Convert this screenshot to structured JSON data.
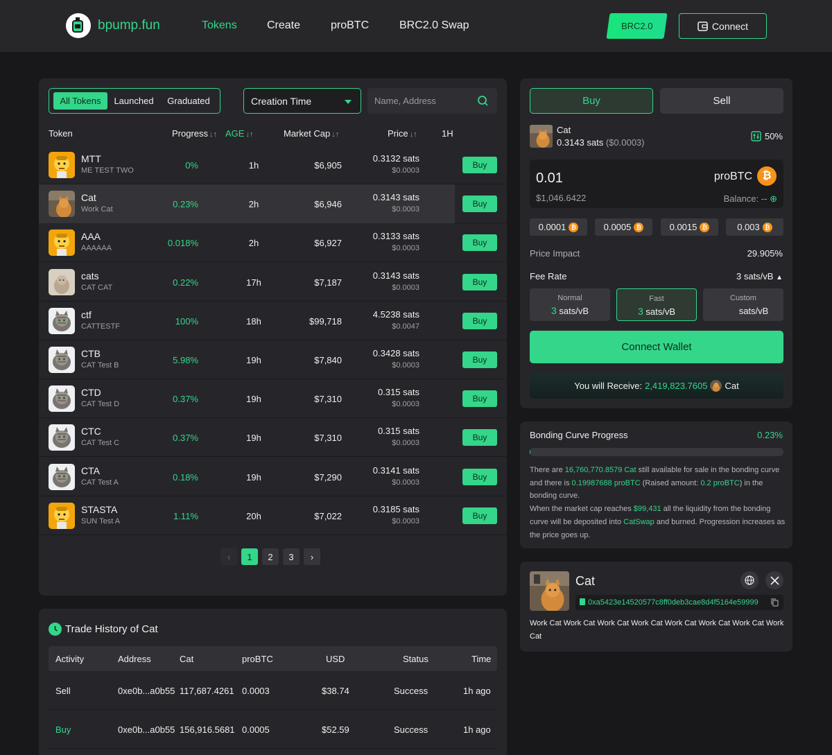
{
  "header": {
    "brand": "bpump.fun",
    "nav": [
      "Tokens",
      "Create",
      "proBTC",
      "BRC2.0 Swap"
    ],
    "network_button": "BRC2.0",
    "connect_button": "Connect"
  },
  "filters": {
    "tabs": [
      "All Tokens",
      "Launched",
      "Graduated"
    ],
    "sort_select": "Creation Time",
    "search_placeholder": "Name, Address"
  },
  "table": {
    "headers": {
      "token": "Token",
      "progress": "Progress",
      "age": "AGE",
      "market_cap": "Market Cap",
      "price": "Price",
      "h1": "1H"
    },
    "buy_label": "Buy",
    "rows": [
      {
        "name": "MTT",
        "sub": "ME TEST TWO",
        "progress": "0%",
        "age": "1h",
        "mcap": "$6,905",
        "price": "0.3132 sats",
        "usd": "$0.0003",
        "avatar": "cartoon"
      },
      {
        "name": "Cat",
        "sub": "Work Cat",
        "progress": "0.23%",
        "age": "2h",
        "mcap": "$6,946",
        "price": "0.3143 sats",
        "usd": "$0.0003",
        "avatar": "workcat"
      },
      {
        "name": "AAA",
        "sub": "AAAAAA",
        "progress": "0.018%",
        "age": "2h",
        "mcap": "$6,927",
        "price": "0.3133 sats",
        "usd": "$0.0003",
        "avatar": "cartoon"
      },
      {
        "name": "cats",
        "sub": "CAT CAT",
        "progress": "0.22%",
        "age": "17h",
        "mcap": "$7,187",
        "price": "0.3143 sats",
        "usd": "$0.0003",
        "avatar": "beige"
      },
      {
        "name": "ctf",
        "sub": "CATTESTF",
        "progress": "100%",
        "age": "18h",
        "mcap": "$99,718",
        "price": "4.5238 sats",
        "usd": "$0.0047",
        "avatar": "tabby"
      },
      {
        "name": "CTB",
        "sub": "CAT Test B",
        "progress": "5.98%",
        "age": "19h",
        "mcap": "$7,840",
        "price": "0.3428 sats",
        "usd": "$0.0003",
        "avatar": "tabby"
      },
      {
        "name": "CTD",
        "sub": "CAT Test D",
        "progress": "0.37%",
        "age": "19h",
        "mcap": "$7,310",
        "price": "0.315 sats",
        "usd": "$0.0003",
        "avatar": "tabby"
      },
      {
        "name": "CTC",
        "sub": "CAT Test C",
        "progress": "0.37%",
        "age": "19h",
        "mcap": "$7,310",
        "price": "0.315 sats",
        "usd": "$0.0003",
        "avatar": "tabby"
      },
      {
        "name": "CTA",
        "sub": "CAT Test A",
        "progress": "0.18%",
        "age": "19h",
        "mcap": "$7,290",
        "price": "0.3141 sats",
        "usd": "$0.0003",
        "avatar": "tabby"
      },
      {
        "name": "STASTA",
        "sub": "SUN Test A",
        "progress": "1.11%",
        "age": "20h",
        "mcap": "$7,022",
        "price": "0.3185 sats",
        "usd": "$0.0003",
        "avatar": "cartoon"
      }
    ]
  },
  "pagination": {
    "prev": "‹",
    "pages": [
      "1",
      "2",
      "3"
    ],
    "next": "›",
    "current": "1"
  },
  "trade_history": {
    "title": "Trade History of Cat",
    "headers": [
      "Activity",
      "Address",
      "Cat",
      "proBTC",
      "USD",
      "Status",
      "Time"
    ],
    "rows": [
      {
        "activity": "Sell",
        "address": "0xe0b...a0b55",
        "cat": "117,687.4261",
        "probtc": "0.0003",
        "usd": "$38.74",
        "status": "Success",
        "time": "1h ago"
      },
      {
        "activity": "Buy",
        "address": "0xe0b...a0b55",
        "cat": "156,916.5681",
        "probtc": "0.0005",
        "usd": "$52.59",
        "status": "Success",
        "time": "1h ago"
      }
    ]
  },
  "trade": {
    "buy_tab": "Buy",
    "sell_tab": "Sell",
    "token_name": "Cat",
    "token_price": "0.3143 sats",
    "token_price_usd": "($0.0003)",
    "slippage": "50%",
    "amount": "0.01",
    "amount_usd": "$1,046.6422",
    "unit": "proBTC",
    "balance_label": "Balance: --",
    "presets": [
      "0.0001",
      "0.0005",
      "0.0015",
      "0.003"
    ],
    "price_impact_label": "Price Impact",
    "price_impact": "29.905%",
    "fee_rate_label": "Fee Rate",
    "fee_rate": "3 sats/vB",
    "fee_options": [
      {
        "label": "Normal",
        "num": "3",
        "unit": "sats/vB"
      },
      {
        "label": "Fast",
        "num": "3",
        "unit": "sats/vB"
      },
      {
        "label": "Custom",
        "num": "",
        "unit": "sats/vB"
      }
    ],
    "connect_wallet": "Connect Wallet",
    "receive_label": "You will Receive:",
    "receive_amount": "2,419,823.7605",
    "receive_token": "Cat"
  },
  "bonding": {
    "title": "Bonding Curve Progress",
    "percent": "0.23%",
    "progress": 0.0023,
    "t1": "There are ",
    "available": "16,760,770.8579 Cat",
    "t2": " still available for sale in the bonding curve and there is ",
    "probtc": "0.19987688 proBTC",
    "t3": " (Raised amount: ",
    "raised": "0.2 proBTC",
    "t4": ") in the bonding curve.",
    "t5": "When the market cap reaches ",
    "target": "$99,431",
    "t6": " all the liquidity from the bonding curve will be deposited into ",
    "swap": "CatSwap",
    "t7": " and burned. Progression increases as the price goes up."
  },
  "token_info": {
    "name": "Cat",
    "address": "0xa5423e14520577c8ff0deb3cae8d4f5164e59999",
    "description": "Work Cat Work Cat Work Cat Work Cat Work Cat Work Cat Work Cat Work Cat"
  },
  "colors": {
    "accent": "#34d68a",
    "background": "#18181b",
    "panel": "#26262a",
    "sell": "#e5322d",
    "bitcoin": "#f7931a"
  }
}
